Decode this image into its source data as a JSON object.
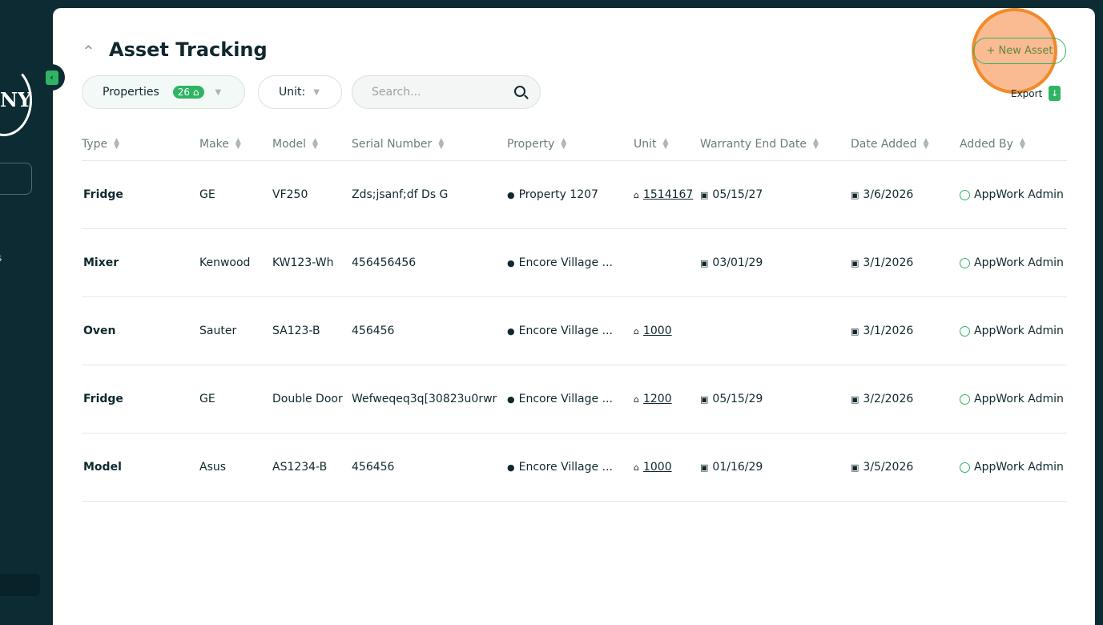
{
  "sidebar": {
    "logo_text": "NY",
    "item_fragment": "s"
  },
  "header": {
    "title": "Asset Tracking",
    "new_asset": "+ New Asset",
    "export": "Export"
  },
  "filters": {
    "properties_label": "Properties",
    "properties_count": "26",
    "unit_label": "Unit:",
    "search_placeholder": "Search..."
  },
  "colors": {
    "accent": "#2fb463",
    "sidebar": "#0c2b33",
    "highlight": "#f18a2a"
  },
  "columns": [
    "Type",
    "Make",
    "Model",
    "Serial Number",
    "Property",
    "Unit",
    "Warranty End Date",
    "Date Added",
    "Added By"
  ],
  "rows": [
    {
      "type": "Fridge",
      "make": "GE",
      "model": "VF250",
      "serial": "Zds;jsanf;df Ds G",
      "property": "Property 1207",
      "unit": "1514167",
      "warranty": "05/15/27",
      "date_added": "3/6/2026",
      "added_by": "AppWork Admin"
    },
    {
      "type": "Mixer",
      "make": "Kenwood",
      "model": "KW123-Wh",
      "serial": "456456456",
      "property": "Encore Village ...",
      "unit": "",
      "warranty": "03/01/29",
      "date_added": "3/1/2026",
      "added_by": "AppWork Admin"
    },
    {
      "type": "Oven",
      "make": "Sauter",
      "model": "SA123-B",
      "serial": "456456",
      "property": "Encore Village ...",
      "unit": "1000",
      "warranty": "",
      "date_added": "3/1/2026",
      "added_by": "AppWork Admin"
    },
    {
      "type": "Fridge",
      "make": "GE",
      "model": "Double Door",
      "serial": "Wefweqeq3q[30823u0rwr",
      "property": "Encore Village ...",
      "unit": "1200",
      "warranty": "05/15/29",
      "date_added": "3/2/2026",
      "added_by": "AppWork Admin"
    },
    {
      "type": "Model",
      "make": "Asus",
      "model": "AS1234-B",
      "serial": "456456",
      "property": "Encore Village ...",
      "unit": "1000",
      "warranty": "01/16/29",
      "date_added": "3/5/2026",
      "added_by": "AppWork Admin"
    }
  ]
}
